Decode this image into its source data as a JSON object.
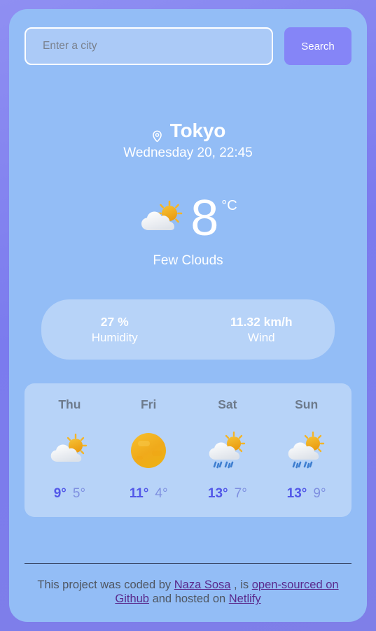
{
  "search": {
    "placeholder": "Enter a city",
    "value": "",
    "button_label": "Search"
  },
  "current": {
    "city": "Tokyo",
    "pin_icon": "location-pin-icon",
    "datetime": "Wednesday 20, 22:45",
    "temperature": "8",
    "unit": "°C",
    "description": "Few Clouds",
    "icon": "sun-behind-cloud-icon"
  },
  "stats": [
    {
      "value": "27 %",
      "label": "Humidity",
      "name": "humidity"
    },
    {
      "value": "11.32 km/h",
      "label": "Wind",
      "name": "wind"
    }
  ],
  "forecast": [
    {
      "day": "Thu",
      "icon": "sun-behind-cloud-icon",
      "max": "9°",
      "min": "5°"
    },
    {
      "day": "Fri",
      "icon": "sun-icon",
      "max": "11°",
      "min": "4°"
    },
    {
      "day": "Sat",
      "icon": "sun-behind-rain-cloud-icon",
      "max": "13°",
      "min": "7°"
    },
    {
      "day": "Sun",
      "icon": "sun-behind-rain-cloud-icon",
      "max": "13°",
      "min": "9°"
    }
  ],
  "footer": {
    "part1": "This project was coded by ",
    "link1": "Naza Sosa",
    "part2": " , is ",
    "link2": "open-sourced on Github",
    "part3": " and hosted on ",
    "link3": "Netlify"
  },
  "colors": {
    "page_background": "#7f7fee",
    "card_background": "#93bdf6",
    "panel_background": "#b7d3f8",
    "accent_button": "#8585f7",
    "temp_max": "#5257e8",
    "temp_min": "#7e8fe0",
    "day_label": "#6d7a8b",
    "link": "#5a2a8c",
    "sun": "#f0a81e",
    "cloud": "#f2f4f7",
    "rain": "#3f7fd0"
  }
}
